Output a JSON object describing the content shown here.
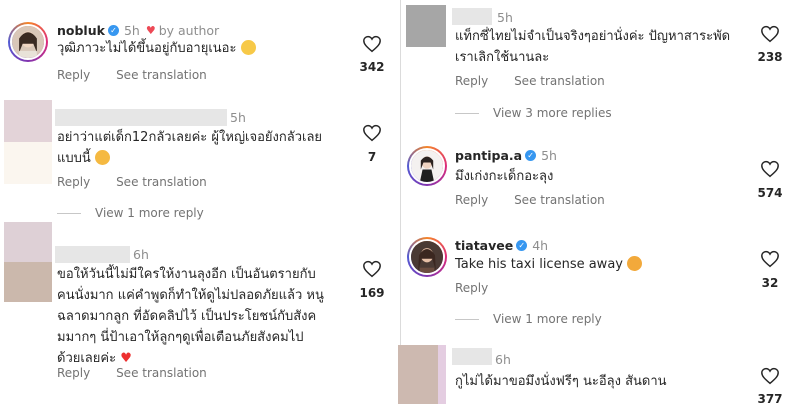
{
  "common": {
    "reply_label": "Reply",
    "see_translation_label": "See translation",
    "verified_mark": "✓",
    "heart_icon": "heart-outline-icon"
  },
  "left_comments": [
    {
      "username": "nobluk",
      "time": "5h",
      "liked_by": "by author",
      "text_lines": [
        "วุฒิภาวะไม่ได้ขึ้นอยู่กับอายุเนอะ"
      ],
      "likes": "342"
    },
    {
      "username": "",
      "time": "5h",
      "text_lines": [
        "อย่าว่าแต่เด็ก12กลัวเลยค่ะ ผู้ใหญ่เจอยังกลัวเลย",
        "แบบนี้"
      ],
      "likes": "7",
      "view_more": "View 1 more reply"
    },
    {
      "username": "",
      "time": "6h",
      "text_lines": [
        "ขอให้วันนี้ไม่มีใครให้งานลุงอีก เป็นอันตรายกับ",
        "คนนั่งมาก แค่คำพูดก็ทำให้ดูไม่ปลอดภัยแล้ว หนู",
        "ฉลาดมากลูก ที่อัดคลิปไว้ เป็นประโยชน์กับสังค",
        "มมากๆ นี่ป้าเอาให้ลูกๆดูเพื่อเตือนภัยสังคมไป",
        "ด้วยเลยค่ะ"
      ],
      "likes": "169"
    }
  ],
  "right_comments": [
    {
      "username": "",
      "time": "5h",
      "text_lines": [
        "แท็กซี่ไทยไม่จำเป็นจริงๆอย่านั่งค่ะ ปัญหาสาระพัด",
        "เราเลิกใช้นานละ"
      ],
      "likes": "238",
      "view_more": "View 3 more replies"
    },
    {
      "username": "pantipa.a",
      "time": "5h",
      "text_lines": [
        "มึงเก่งกะเด็กอะลุง"
      ],
      "likes": "574"
    },
    {
      "username": "tiatavee",
      "time": "4h",
      "text_lines": [
        "Take his taxi license away"
      ],
      "likes": "32",
      "view_more": "View 1 more reply"
    },
    {
      "username": "",
      "time": "6h",
      "text_lines": [
        "กูไม่ได้มาขอมึงนั่งฟรีๆ นะอีลุง สันดาน"
      ],
      "likes": "377"
    }
  ]
}
